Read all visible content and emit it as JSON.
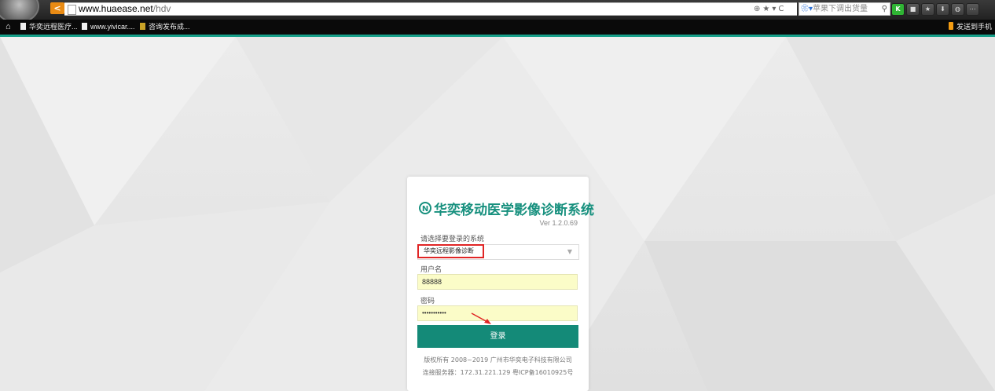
{
  "browser": {
    "url_host": "www.huaease.net",
    "url_path": "/hdv",
    "back_label": "<",
    "search_placeholder": "苹果下调出货量",
    "search_engine_icon": "paw-icon",
    "bookmarks": [
      "华奕远程医疗...",
      "www.yivicar....",
      "咨询发布成..."
    ],
    "send_to_phone": "发送到手机",
    "toolbar_buttons": [
      "K",
      "lock-icon",
      "star-icon",
      "download-icon",
      "gamepad-icon",
      "menu-icon"
    ]
  },
  "login": {
    "title": "华奕移动医学影像诊断系统",
    "logo_glyph": "N",
    "version": "Ver 1.2.0.69",
    "system_label": "请选择要登录的系统",
    "system_value": "华奕远程影像诊断",
    "username_label": "用户名",
    "username_value": "88888",
    "password_label": "密码",
    "password_value": "•••••••••••",
    "login_button": "登录",
    "copyright": "版权所有 2008~2019 广州市华奕电子科技有限公司",
    "server_info": "连接服务器：172.31.221.129  粤ICP备16010925号"
  },
  "colors": {
    "accent": "#148a78",
    "highlight_box": "#e02525",
    "input_bg": "#fbfcc8"
  }
}
